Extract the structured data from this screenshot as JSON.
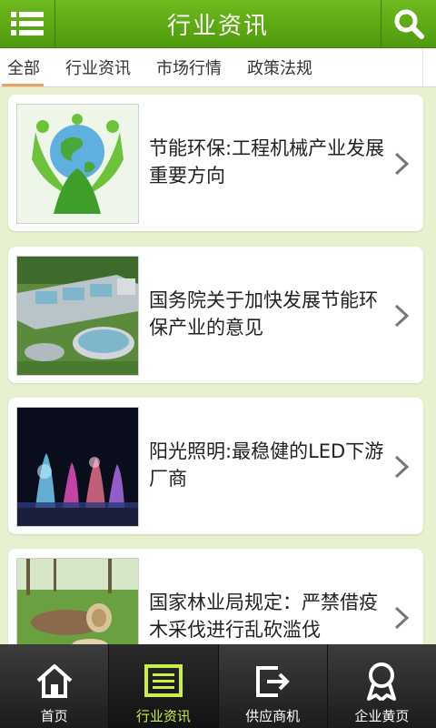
{
  "header": {
    "title": "行业资讯",
    "menu_icon": "menu-icon",
    "search_icon": "search-icon"
  },
  "tabs": [
    {
      "label": "全部",
      "active": true
    },
    {
      "label": "行业资讯"
    },
    {
      "label": "市场行情"
    },
    {
      "label": "政策法规"
    }
  ],
  "articles": [
    {
      "title": "节能环保:工程机械产业发展重要方向",
      "thumb": "green-earth-people-image"
    },
    {
      "title": "国务院关于加快发展节能环保产业的意见",
      "thumb": "water-treatment-plant-image"
    },
    {
      "title": "阳光照明:最稳健的LED下游厂商",
      "thumb": "led-fountain-night-image"
    },
    {
      "title": "国家林业局规定：严禁借疫木采伐进行乱砍滥伐",
      "thumb": "cut-tree-stump-image"
    }
  ],
  "bottom_nav": [
    {
      "label": "首页",
      "icon": "home-icon"
    },
    {
      "label": "行业资讯",
      "icon": "news-icon",
      "active": true
    },
    {
      "label": "供应商机",
      "icon": "supply-icon"
    },
    {
      "label": "企业黄页",
      "icon": "award-icon"
    }
  ],
  "colors": {
    "header_green": "#5aa616",
    "background": "#e8f1cf",
    "tab_underline": "#e9a35c",
    "nav_active_text": "#c8ef4a"
  }
}
